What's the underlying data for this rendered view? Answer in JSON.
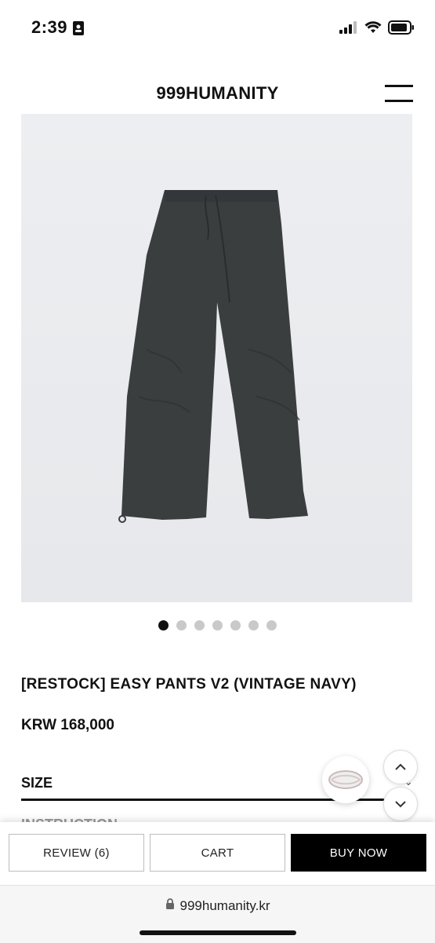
{
  "status_bar": {
    "time": "2:39"
  },
  "header": {
    "brand": "999HUMANITY"
  },
  "product": {
    "title": "[RESTOCK] EASY PANTS V2 (VINTAGE NAVY)",
    "price": "KRW 168,000",
    "carousel": {
      "total": 7,
      "active_index": 0
    }
  },
  "options": {
    "size_label": "SIZE",
    "instruction_label": "INSTRUCTION"
  },
  "actions": {
    "review_label": "REVIEW (6)",
    "cart_label": "CART",
    "buy_label": "BUY NOW"
  },
  "browser": {
    "url": "999humanity.kr"
  },
  "colors": {
    "pants": "#3b3e3f",
    "background": "#e9ebee",
    "buy_button": "#000000"
  }
}
